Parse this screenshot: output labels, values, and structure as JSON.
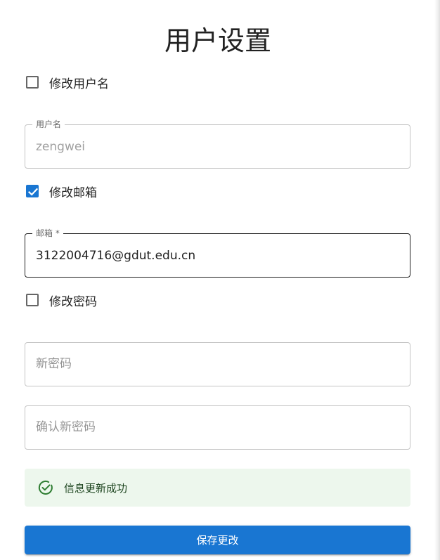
{
  "page": {
    "title": "用户设置"
  },
  "username_toggle": {
    "label": "修改用户名",
    "checked": false
  },
  "username_field": {
    "label": "用户名",
    "value": "zengwei",
    "disabled": true
  },
  "email_toggle": {
    "label": "修改邮箱",
    "checked": true
  },
  "email_field": {
    "label": "邮箱 *",
    "value": "3122004716@gdut.edu.cn"
  },
  "password_toggle": {
    "label": "修改密码",
    "checked": false
  },
  "new_password_field": {
    "placeholder": "新密码"
  },
  "confirm_password_field": {
    "placeholder": "确认新密码"
  },
  "alert": {
    "message": "信息更新成功",
    "icon": "check-circle-icon",
    "severity": "success"
  },
  "actions": {
    "save_label": "保存更改"
  },
  "colors": {
    "primary": "#1976d2",
    "success_bg": "#edf7ed",
    "success_text": "#1e4620",
    "success_icon": "#2e7d32"
  }
}
